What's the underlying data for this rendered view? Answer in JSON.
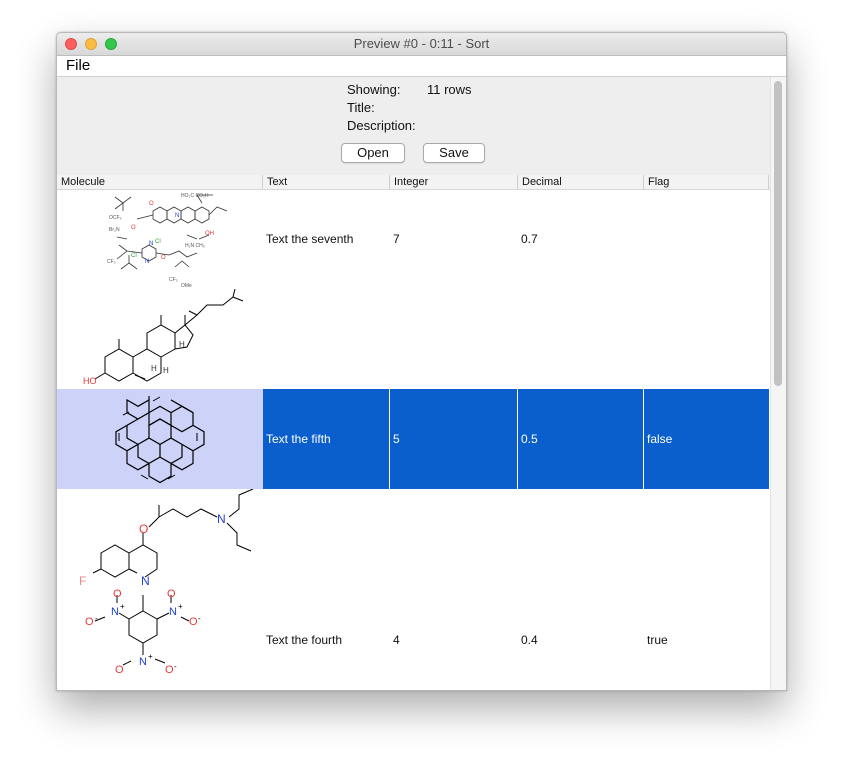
{
  "window": {
    "title": "Preview #0 - 0:11 - Sort"
  },
  "menu": {
    "file": "File"
  },
  "info": {
    "showing_label": "Showing:",
    "showing_value": "11 rows",
    "title_label": "Title:",
    "description_label": "Description:"
  },
  "buttons": {
    "open": "Open",
    "save": "Save"
  },
  "columns": [
    "Molecule",
    "Text",
    "Integer",
    "Decimal",
    "Flag"
  ],
  "rows": [
    {
      "text": "Text the seventh",
      "integer": "7",
      "decimal": "0.7",
      "flag": ""
    },
    {
      "text": "",
      "integer": "",
      "decimal": "",
      "flag": ""
    },
    {
      "text": "Text the fifth",
      "integer": "5",
      "decimal": "0.5",
      "flag": "false"
    },
    {
      "text": "",
      "integer": "",
      "decimal": "",
      "flag": ""
    },
    {
      "text": "Text the fourth",
      "integer": "4",
      "decimal": "0.4",
      "flag": "true"
    }
  ],
  "atom_labels": {
    "cholesterol_ho": "HO",
    "cholesterol_h": "H",
    "quinoline_o": "O",
    "quinoline_n": "N",
    "quinoline_f": "F",
    "tnt_n": "N",
    "tnt_o": "O",
    "tnt_plus": "+",
    "tnt_minus": "-"
  },
  "colors": {
    "selection": "#0a5fcc",
    "selection_mol": "#ccd2f8",
    "oxygen": "#e53935",
    "nitrogen": "#1e40d0"
  }
}
